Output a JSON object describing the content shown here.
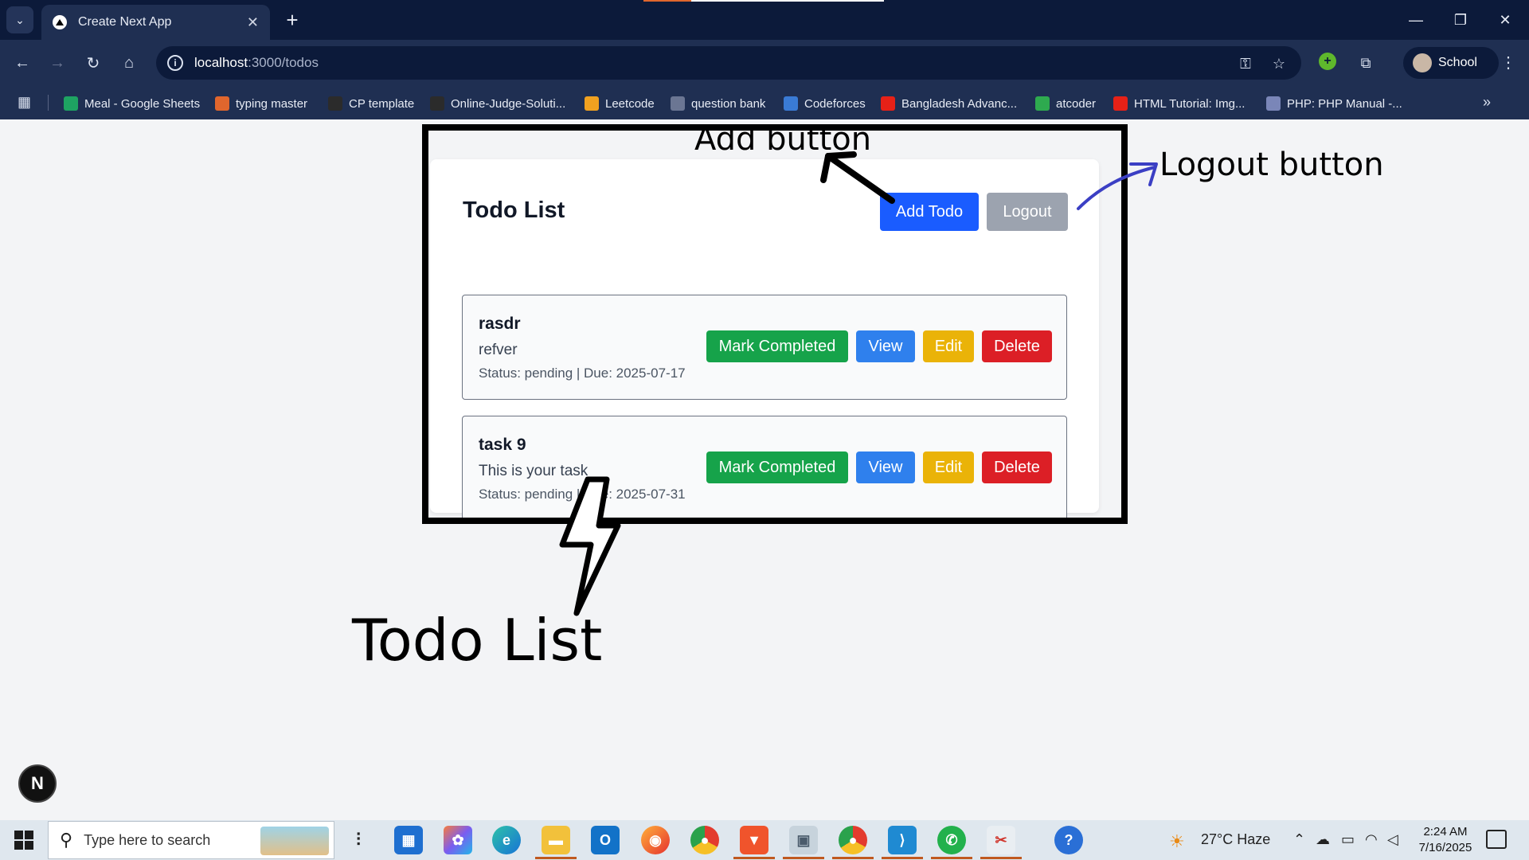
{
  "browser": {
    "tab_title": "Create Next App",
    "tab_close": "✕",
    "new_tab": "+",
    "url_host": "localhost",
    "url_path": ":3000/todos",
    "profile_name": "School",
    "window_controls": {
      "minimize": "—",
      "restore": "❐",
      "close": "✕"
    },
    "nav": {
      "back": "←",
      "forward": "→",
      "reload": "↻",
      "home": "⌂"
    }
  },
  "bookmarks": [
    {
      "label": "Meal - Google Sheets",
      "icon": "sheets-icon",
      "color": "#1ea362"
    },
    {
      "label": "typing master",
      "icon": "typing-master-icon",
      "color": "#e0662d"
    },
    {
      "label": "CP template",
      "icon": "github-icon",
      "color": "#2b2b2b"
    },
    {
      "label": "Online-Judge-Soluti...",
      "icon": "github-icon",
      "color": "#2b2b2b"
    },
    {
      "label": "Leetcode",
      "icon": "leetcode-icon",
      "color": "#f0a120"
    },
    {
      "label": "question bank",
      "icon": "globe-icon",
      "color": "#6b7693"
    },
    {
      "label": "Codeforces",
      "icon": "codeforces-icon",
      "color": "#3a7bd5"
    },
    {
      "label": "Bangladesh Advanc...",
      "icon": "youtube-icon",
      "color": "#e62117"
    },
    {
      "label": "atcoder",
      "icon": "atcoder-icon",
      "color": "#2eaa4f"
    },
    {
      "label": "HTML Tutorial: Img...",
      "icon": "youtube-icon",
      "color": "#e62117"
    },
    {
      "label": "PHP: PHP Manual -...",
      "icon": "php-icon",
      "color": "#7a86b8"
    }
  ],
  "page": {
    "title": "Todo List",
    "add_label": "Add Todo",
    "logout_label": "Logout",
    "todos": [
      {
        "title": "rasdr",
        "description": "refver",
        "meta": "Status: pending | Due: 2025-07-17"
      },
      {
        "title": "task 9",
        "description": "This is your task",
        "meta": "Status: pending | Due: 2025-07-31"
      }
    ],
    "actions": {
      "complete": "Mark Completed",
      "view": "View",
      "edit": "Edit",
      "delete": "Delete"
    },
    "next_badge": "N"
  },
  "annotations": {
    "add": "Add button",
    "logout": "Logout button",
    "list": "Todo List"
  },
  "taskbar": {
    "search_placeholder": "Type here to search",
    "weather": "27°C  Haze",
    "time": "2:24 AM",
    "date": "7/16/2025"
  },
  "colors": {
    "add_button": "#1a5cff",
    "logout_button": "#9ca3af",
    "complete_button": "#16a34a",
    "view_button": "#2f80ed",
    "edit_button": "#eab308",
    "delete_button": "#dc1f26"
  }
}
